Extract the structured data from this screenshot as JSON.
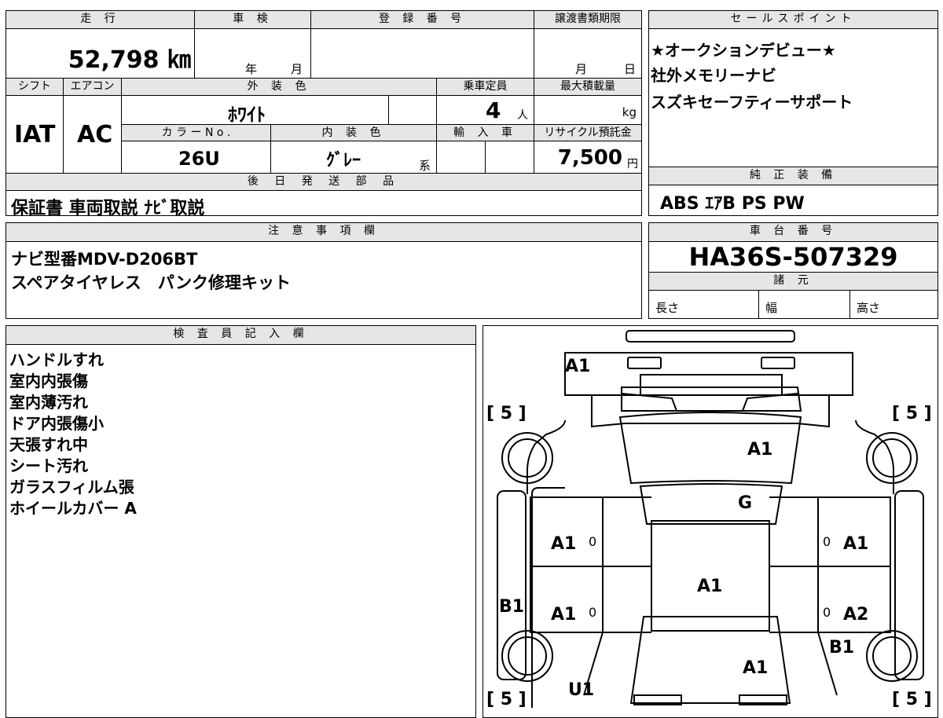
{
  "mileage": {
    "label": "走 行",
    "value": "52,798 ㎞"
  },
  "inspection": {
    "label": "車 検",
    "year_unit": "年",
    "month_unit": "月"
  },
  "registration": {
    "label": "登 録 番 号"
  },
  "transfer_deadline": {
    "label": "譲渡書類期限",
    "month_unit": "月",
    "day_unit": "日"
  },
  "shift": {
    "label": "シフト",
    "value": "IAT"
  },
  "aircon": {
    "label": "エアコン",
    "value": "AC"
  },
  "exterior_color": {
    "label": "外 装 色",
    "value": "ﾎﾜｲﾄ"
  },
  "capacity": {
    "label": "乗車定員",
    "value": "4",
    "unit": "人"
  },
  "max_load": {
    "label": "最大積載量",
    "unit": "kg"
  },
  "color_no": {
    "label": "カ ラ ー N o .",
    "value": "26U"
  },
  "interior_color": {
    "label": "内 装 色",
    "value": "ｸﾞﾚｰ",
    "suffix": "系"
  },
  "import": {
    "label": "輸 入 車"
  },
  "recycle": {
    "label": "リサイクル預託金",
    "value": "7,500",
    "unit": "円"
  },
  "later_parts": {
    "label": "後 日 発 送 部 品",
    "value": "保証書 車両取説 ﾅﾋﾞ取説"
  },
  "sales_points": {
    "label": "セールスポイント",
    "lines": [
      "★オークションデビュー★",
      "社外メモリーナビ",
      "スズキセーフティーサポート"
    ]
  },
  "genuine_equipment": {
    "label": "純 正 装 備",
    "value": "ABS ｴｱB PS PW"
  },
  "notes": {
    "label": "注 意 事 項 欄",
    "lines": [
      "ナビ型番MDV-D206BT",
      "スペアタイヤレス　パンク修理キット"
    ]
  },
  "chassis": {
    "label": "車 台 番 号",
    "value": "HA36S-507329"
  },
  "specs": {
    "label": "諸 元",
    "length": "長さ",
    "width": "幅",
    "height": "高さ"
  },
  "inspector": {
    "label": "検 査 員 記 入 欄",
    "lines": [
      "ハンドルすれ",
      "室内内張傷",
      "室内薄汚れ",
      "ドア内張傷小",
      "天張すれ中",
      "シート汚れ",
      "ガラスフィルム張",
      "ホイールカバー A"
    ]
  },
  "diagram": {
    "tire_fl": "[ 5 ]",
    "tire_fr": "[ 5 ]",
    "tire_rl": "[ 5 ]",
    "tire_rr": "[ 5 ]",
    "front_bumper": "A1",
    "hood": "A1",
    "windshield": "G",
    "roof": "A1",
    "front_left_door": "A1",
    "front_right_door": "A1",
    "rear_left_door": "A1",
    "rear_right_door": "A2",
    "left_sill": "B1",
    "right_fender_rear": "B1",
    "rear_hatch": "A1",
    "rear_left": "U1",
    "door_mark": "0"
  }
}
